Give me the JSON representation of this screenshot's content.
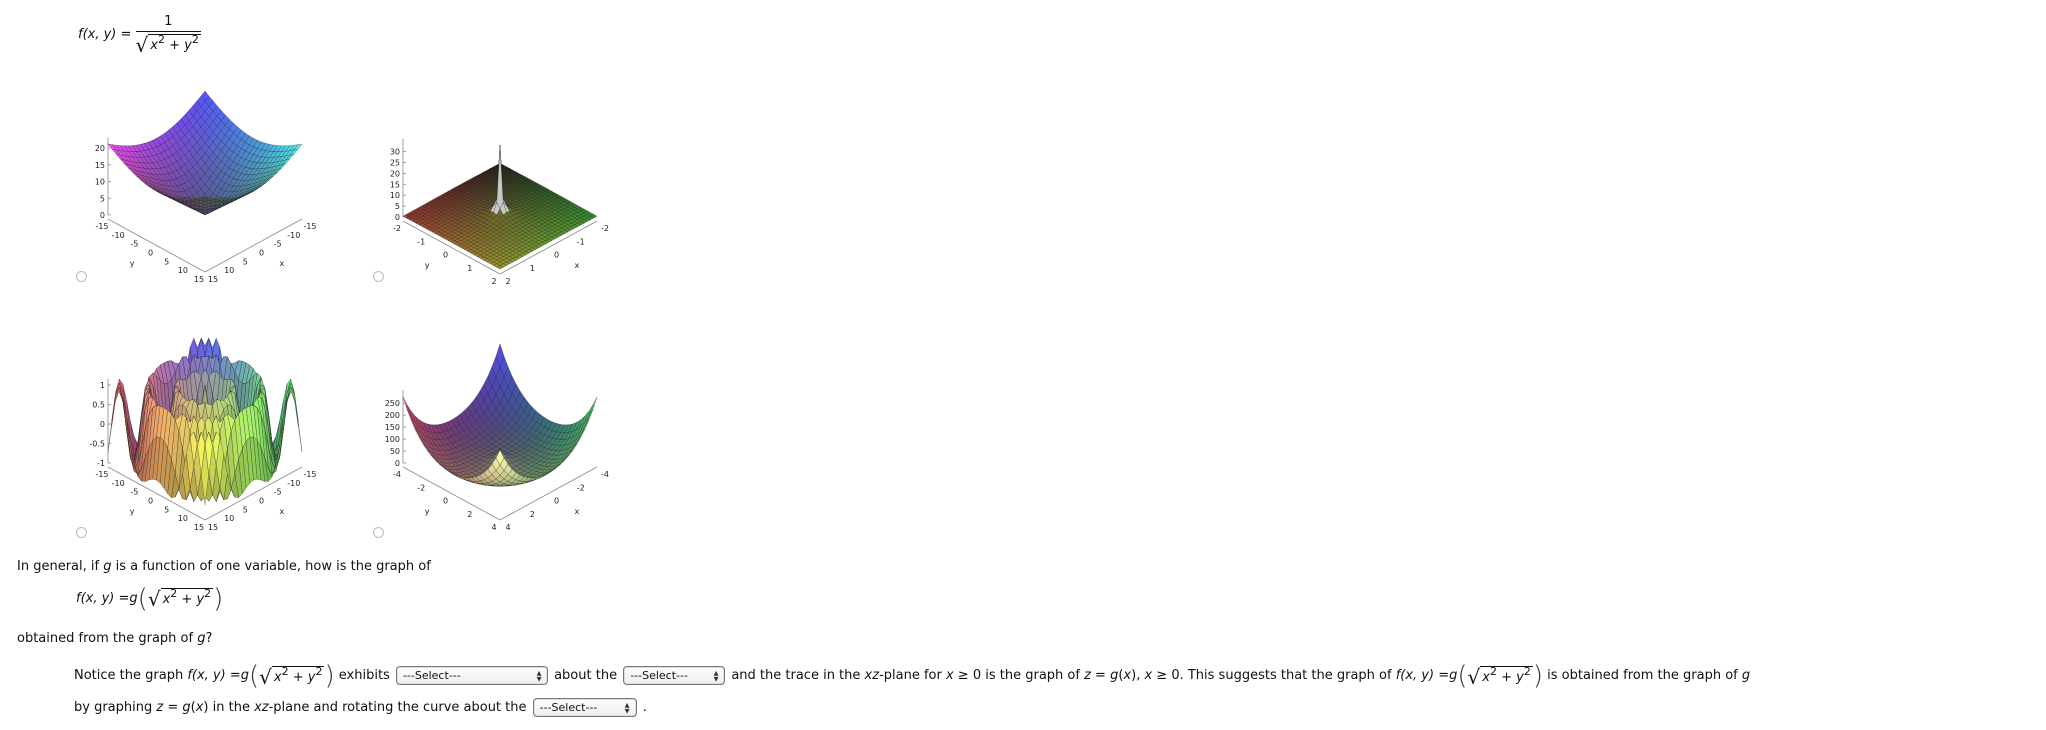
{
  "top_formula": {
    "lhs": "f(x, y) =",
    "numerator": "1",
    "sqrt_sign": "√",
    "x": "x",
    "y": "y",
    "exp": "2",
    "plus": " + "
  },
  "plots": [
    {
      "x_label": "x",
      "y_label": "y",
      "x_ticks": [
        "-15",
        "-10",
        "-5",
        "0",
        "5",
        "10",
        "15"
      ],
      "y_ticks": [
        "-15",
        "-10",
        "-5",
        "0",
        "5",
        "10",
        "15"
      ],
      "z_ticks": [
        "0",
        "5",
        "10",
        "15",
        "20"
      ],
      "x_range": [
        -15,
        15
      ],
      "z_range": [
        0,
        21.2
      ],
      "colors": [
        "#4b4be6",
        "#e345e0",
        "#46e3e0",
        "#5a5a3c"
      ]
    },
    {
      "x_label": "x",
      "y_label": "y",
      "x_ticks": [
        "-2",
        "-1",
        "0",
        "1",
        "2"
      ],
      "y_ticks": [
        "-2",
        "-1",
        "0",
        "1",
        "2"
      ],
      "z_ticks": [
        "0",
        "5",
        "10",
        "15",
        "20",
        "25",
        "30"
      ],
      "x_range": [
        -2,
        2
      ],
      "z_range": [
        0,
        33
      ],
      "colors": [
        "#2a2420",
        "#d24a40",
        "#46cc3e",
        "#d6d23e"
      ]
    },
    {
      "x_label": "x",
      "y_label": "y",
      "x_ticks": [
        "-15",
        "-10",
        "-5",
        "0",
        "5",
        "10",
        "15"
      ],
      "y_ticks": [
        "-15",
        "-10",
        "-5",
        "0",
        "5",
        "10",
        "15"
      ],
      "z_ticks": [
        "-1",
        "-0.5",
        "0",
        "0.5",
        "1"
      ],
      "x_range": [
        -15,
        15
      ],
      "z_range": [
        -1,
        1
      ],
      "colors": [
        "#5a5af2",
        "#f2606a",
        "#5af26a",
        "#f2f25a"
      ]
    },
    {
      "x_label": "x",
      "y_label": "y",
      "x_ticks": [
        "-4",
        "-2",
        "0",
        "2",
        "4"
      ],
      "y_ticks": [
        "-4",
        "-2",
        "0",
        "2",
        "4"
      ],
      "z_ticks": [
        "0",
        "50",
        "100",
        "150",
        "200",
        "250"
      ],
      "x_range": [
        -4,
        4
      ],
      "z_range": [
        0,
        280
      ],
      "colors": [
        "#4848d0",
        "#c84468",
        "#44c468",
        "#f4f2a8"
      ]
    }
  ],
  "question": {
    "line1": [
      {
        "t": "In general, if "
      },
      {
        "t": "g",
        "i": true
      },
      {
        "t": " is a function of one variable, how is the graph of"
      }
    ],
    "line3": [
      {
        "t": "obtained from the graph of "
      },
      {
        "t": "g",
        "i": true
      },
      {
        "t": "?"
      }
    ]
  },
  "g_formula": {
    "lhs_f": "f",
    "lhs_args": "(x, y) = ",
    "g": "g",
    "open": "(",
    "close": ")",
    "sqrt_sign": "√",
    "x": "x",
    "y": "y",
    "exp": "2",
    "plus": " + "
  },
  "answer": {
    "segments": [
      {
        "t": "Notice the graph "
      },
      {
        "type": "formula"
      },
      {
        "t": " exhibits "
      },
      {
        "type": "select",
        "value": "---Select---",
        "w": 152
      },
      {
        "t": " about the "
      },
      {
        "type": "select",
        "value": "---Select---",
        "w": 102
      },
      {
        "t": " and the trace in the "
      },
      {
        "t": "xz",
        "i": true
      },
      {
        "t": "-plane for "
      },
      {
        "t": "x",
        "i": true
      },
      {
        "t": " ≥ 0 is the graph of "
      },
      {
        "t": "z",
        "i": true
      },
      {
        "t": " = "
      },
      {
        "t": "g",
        "i": true
      },
      {
        "t": "("
      },
      {
        "t": "x",
        "i": true
      },
      {
        "t": "), "
      },
      {
        "t": "x",
        "i": true
      },
      {
        "t": " ≥ 0. This suggests that the graph of "
      },
      {
        "type": "formula"
      },
      {
        "t": " is obtained from the graph of "
      },
      {
        "t": "g",
        "i": true
      },
      {
        "type": "br"
      },
      {
        "t": "by graphing "
      },
      {
        "t": "z",
        "i": true
      },
      {
        "t": " = "
      },
      {
        "t": "g",
        "i": true
      },
      {
        "t": "("
      },
      {
        "t": "x",
        "i": true
      },
      {
        "t": ") in the "
      },
      {
        "t": "xz",
        "i": true
      },
      {
        "t": "-plane and rotating the curve about the "
      },
      {
        "type": "select",
        "value": "---Select---",
        "w": 104
      },
      {
        "t": " ."
      }
    ]
  }
}
